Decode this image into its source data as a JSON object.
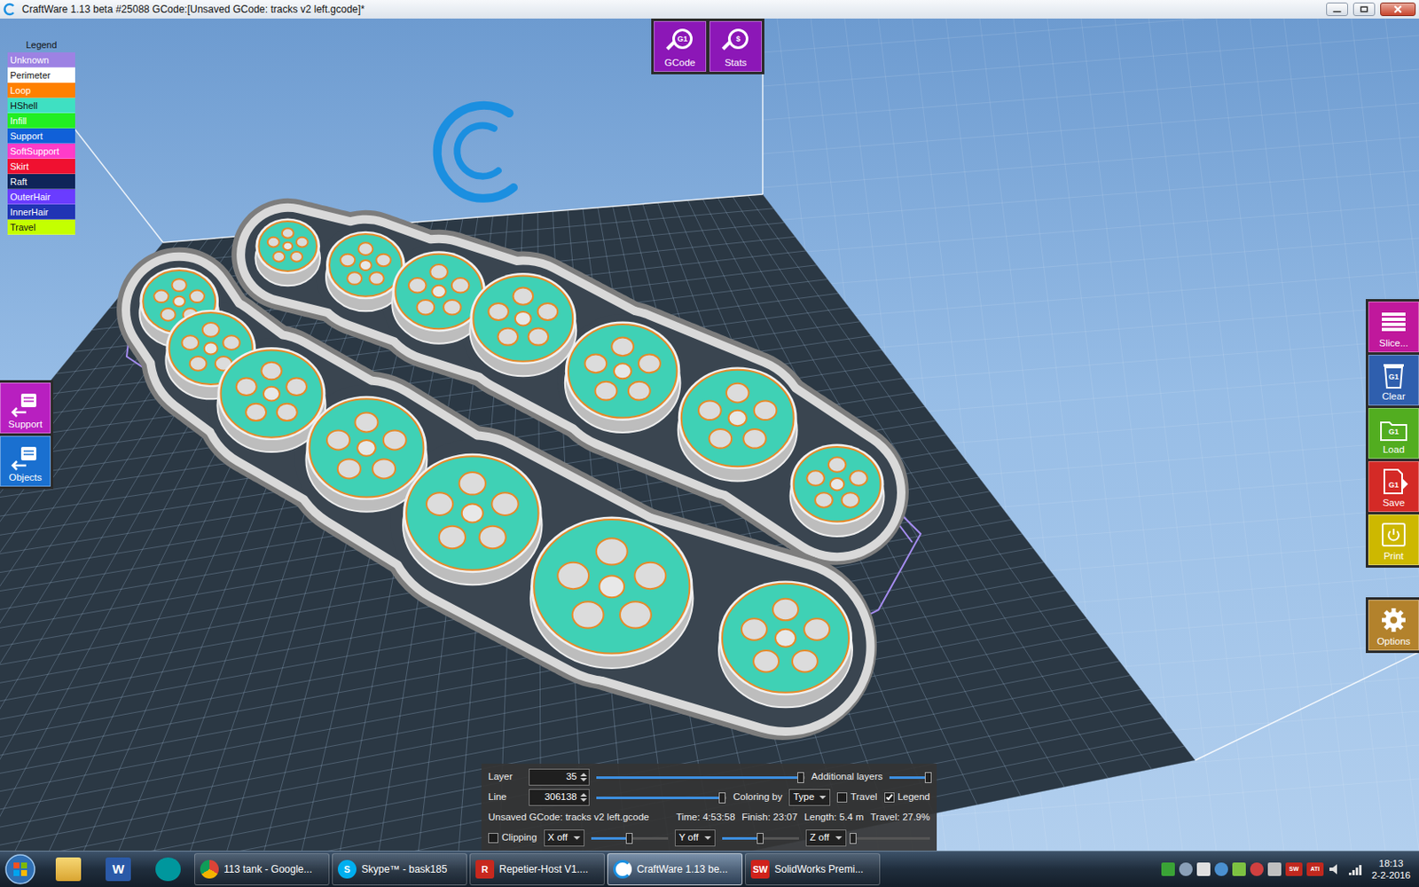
{
  "window": {
    "title": "CraftWare 1.13 beta #25088   GCode:[Unsaved GCode: tracks v2 left.gcode]*"
  },
  "legend": {
    "title": "Legend",
    "items": [
      {
        "label": "Unknown",
        "color": "#9d82e3"
      },
      {
        "label": "Perimeter",
        "color": "#ffffff"
      },
      {
        "label": "Loop",
        "color": "#ff8000"
      },
      {
        "label": "HShell",
        "color": "#3fe0c2"
      },
      {
        "label": "Infill",
        "color": "#22ee22"
      },
      {
        "label": "Support",
        "color": "#1060d8"
      },
      {
        "label": "SoftSupport",
        "color": "#ff3cc8"
      },
      {
        "label": "Skirt",
        "color": "#f01030"
      },
      {
        "label": "Raft",
        "color": "#0f2458"
      },
      {
        "label": "OuterHair",
        "color": "#6a3cff"
      },
      {
        "label": "InnerHair",
        "color": "#2034b4"
      },
      {
        "label": "Travel",
        "color": "#c4ff00"
      }
    ]
  },
  "top_buttons": [
    {
      "label": "GCode",
      "glyph": "G1"
    },
    {
      "label": "Stats",
      "glyph": "$"
    }
  ],
  "left_buttons": [
    {
      "label": "Support",
      "color": "#b81fc0"
    },
    {
      "label": "Objects",
      "color": "#1a70d0"
    }
  ],
  "right_buttons": [
    {
      "label": "Slice...",
      "color": "#c0189c",
      "kind": "slice",
      "glyph": ""
    },
    {
      "label": "Clear",
      "color": "#2f5fae",
      "kind": "clear",
      "glyph": "G1"
    },
    {
      "label": "Load",
      "color": "#52ad20",
      "kind": "load",
      "glyph": "G1"
    },
    {
      "label": "Save",
      "color": "#d42a26",
      "kind": "save",
      "glyph": "G1"
    },
    {
      "label": "Print",
      "color": "#cdb800",
      "kind": "print",
      "glyph": ""
    }
  ],
  "options_button": {
    "label": "Options",
    "color": "#b3822c"
  },
  "controls": {
    "layer": {
      "label": "Layer",
      "value": "35",
      "level": 0.98
    },
    "additional_layers": {
      "label": "Additional layers",
      "level": 0.95
    },
    "line": {
      "label": "Line",
      "value": "306138",
      "level": 0.97
    },
    "coloring_by": {
      "label": "Coloring by",
      "value": "Type"
    },
    "travel": {
      "label": "Travel",
      "checked": false
    },
    "legend": {
      "label": "Legend",
      "checked": true
    },
    "file": "Unsaved GCode: tracks v2 left.gcode",
    "stats": [
      "Time: 4:53:58",
      "Finish: 23:07",
      "Length: 5.4 m",
      "Travel: 27.9%"
    ],
    "clipping": {
      "label": "Clipping",
      "checked": false
    },
    "axes": [
      {
        "value": "X off",
        "level": 0.5
      },
      {
        "value": "Y off",
        "level": 0.5
      },
      {
        "value": "Z off",
        "level": 0.0
      }
    ]
  },
  "taskbar": {
    "pinned": [
      {
        "kind": "folder",
        "glyph": ""
      },
      {
        "kind": "word",
        "glyph": "W"
      },
      {
        "kind": "arduino",
        "glyph": ""
      }
    ],
    "tasks": [
      {
        "label": "113 tank - Google...",
        "selected": false,
        "kind": "chrome",
        "glyph": ""
      },
      {
        "label": "Skype™ - bask185",
        "selected": false,
        "kind": "skype",
        "glyph": "S"
      },
      {
        "label": "Repetier-Host V1....",
        "selected": false,
        "kind": "repetier",
        "glyph": "R"
      },
      {
        "label": "CraftWare 1.13 be...",
        "selected": true,
        "kind": "craftware",
        "glyph": ""
      },
      {
        "label": "SolidWorks Premi...",
        "selected": false,
        "kind": "solidworks",
        "glyph": "SW"
      }
    ],
    "tray_glyphs": [
      "SW",
      "ATI"
    ],
    "clock": {
      "time": "18:13",
      "date": "2-2-2016"
    }
  }
}
